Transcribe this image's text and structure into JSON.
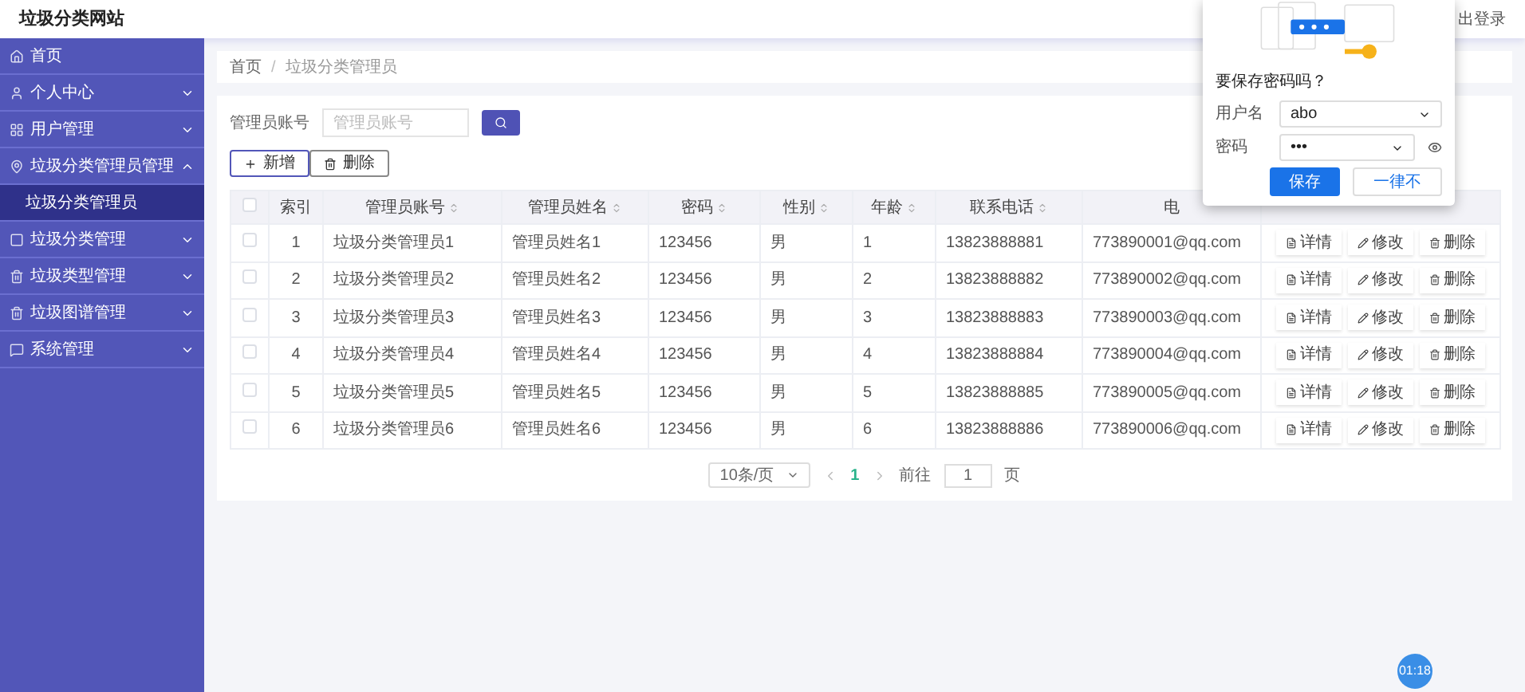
{
  "site_title": "垃圾分类网站",
  "logout": "出登录",
  "sidebar": {
    "items": [
      {
        "label": "首页",
        "kind": "link"
      },
      {
        "label": "个人中心",
        "kind": "menu",
        "expanded": false
      },
      {
        "label": "用户管理",
        "kind": "menu",
        "expanded": false
      },
      {
        "label": "垃圾分类管理员管理",
        "kind": "menu",
        "expanded": true,
        "children": [
          {
            "label": "垃圾分类管理员",
            "selected": true
          }
        ]
      },
      {
        "label": "垃圾分类管理",
        "kind": "menu",
        "expanded": false
      },
      {
        "label": "垃圾类型管理",
        "kind": "menu",
        "expanded": false
      },
      {
        "label": "垃圾图谱管理",
        "kind": "menu",
        "expanded": false
      },
      {
        "label": "系统管理",
        "kind": "menu",
        "expanded": false
      }
    ]
  },
  "breadcrumb": {
    "separator": "/",
    "items": [
      "首页",
      "垃圾分类管理员"
    ]
  },
  "search": {
    "label": "管理员账号",
    "placeholder": "管理员账号"
  },
  "toolbar": {
    "add": "新增",
    "delete": "删除"
  },
  "table": {
    "select_all": false,
    "columns": [
      {
        "label": "索引",
        "sortable": false
      },
      {
        "label": "管理员账号",
        "sortable": true
      },
      {
        "label": "管理员姓名",
        "sortable": true
      },
      {
        "label": "密码",
        "sortable": true
      },
      {
        "label": "性别",
        "sortable": true
      },
      {
        "label": "年龄",
        "sortable": true
      },
      {
        "label": "联系电话",
        "sortable": true
      },
      {
        "label": "电",
        "sortable": false
      }
    ],
    "rows": [
      {
        "checked": false,
        "cells": [
          "1",
          "垃圾分类管理员1",
          "管理员姓名1",
          "123456",
          "男",
          "1",
          "13823888881",
          "773890001@qq.com"
        ],
        "actions": [
          "详情",
          "修改",
          "删除"
        ]
      },
      {
        "checked": false,
        "cells": [
          "2",
          "垃圾分类管理员2",
          "管理员姓名2",
          "123456",
          "男",
          "2",
          "13823888882",
          "773890002@qq.com"
        ],
        "actions": [
          "详情",
          "修改",
          "删除"
        ]
      },
      {
        "checked": false,
        "cells": [
          "3",
          "垃圾分类管理员3",
          "管理员姓名3",
          "123456",
          "男",
          "3",
          "13823888883",
          "773890003@qq.com"
        ],
        "actions": [
          "详情",
          "修改",
          "删除"
        ]
      },
      {
        "checked": false,
        "cells": [
          "4",
          "垃圾分类管理员4",
          "管理员姓名4",
          "123456",
          "男",
          "4",
          "13823888884",
          "773890004@qq.com"
        ],
        "actions": [
          "详情",
          "修改",
          "删除"
        ]
      },
      {
        "checked": false,
        "cells": [
          "5",
          "垃圾分类管理员5",
          "管理员姓名5",
          "123456",
          "男",
          "5",
          "13823888885",
          "773890005@qq.com"
        ],
        "actions": [
          "详情",
          "修改",
          "删除"
        ]
      },
      {
        "checked": false,
        "cells": [
          "6",
          "垃圾分类管理员6",
          "管理员姓名6",
          "123456",
          "男",
          "6",
          "13823888886",
          "773890006@qq.com"
        ],
        "actions": [
          "详情",
          "修改",
          "删除"
        ]
      }
    ]
  },
  "pagination": {
    "page_size": "10条/页",
    "pages": [
      {
        "label": "1",
        "selected": true
      }
    ],
    "goto_label": "前往",
    "goto_value": "1",
    "goto_suffix": "页"
  },
  "password_popup": {
    "title": "要保存密码吗？",
    "username_label": "用户名",
    "username": "abo",
    "password_label": "密码",
    "password": "•••",
    "save": "保存",
    "never": "一律不"
  },
  "timer": "01:18"
}
